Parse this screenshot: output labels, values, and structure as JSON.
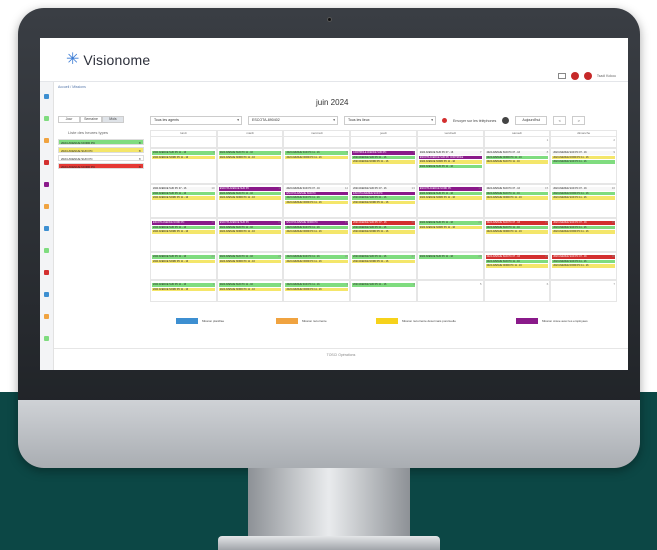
{
  "app": {
    "logo_text": "Visionome",
    "breadcrumb": "Accueil / Missions",
    "user": "Tsadi Kokou",
    "footer": "TOSCI Opérations"
  },
  "calendar": {
    "month_title": "juin 2024",
    "views": [
      "Jour",
      "Semaine",
      "Mois"
    ],
    "active_view": "Mois",
    "filters": {
      "agents": "Tous les agents",
      "code": "ESCOTA-890402",
      "lieux": "Tous les lieux"
    },
    "envoyer_label": "Envoyer sur les téléphones",
    "today_label": "Aujourd'hui",
    "prev_label": "<",
    "next_label": ">",
    "weekday_headers": [
      "lundi",
      "mardi",
      "mercredi",
      "jeudi",
      "vendredi",
      "samedi",
      "dimanche"
    ]
  },
  "legend": {
    "title": "Liste des heures types",
    "items": [
      {
        "label": "2024 AVENUE NORD PC",
        "color": "#7fdc7f"
      },
      {
        "label": "2024 AVENUE SUD PC",
        "color": "#f4e66a"
      },
      {
        "label": "2024 AVENUE SUD PC",
        "color": "#ffffff"
      },
      {
        "label": "2024 AVENUE NORD PC",
        "color": "#e53935"
      }
    ]
  },
  "weeks": [
    [
      {
        "n": "",
        "events": []
      },
      {
        "n": "",
        "events": []
      },
      {
        "n": "",
        "events": []
      },
      {
        "n": "",
        "events": []
      },
      {
        "n": "",
        "events": []
      },
      {
        "n": "1",
        "events": []
      },
      {
        "n": "2",
        "events": []
      }
    ],
    [
      {
        "n": "3",
        "events": [
          {
            "t": "2024 AVENUE SUD PC 11 - 16",
            "c": "green"
          },
          {
            "t": "2024 AVENUE NORD PC 11 - 16",
            "c": "yellow"
          }
        ]
      },
      {
        "n": "4",
        "events": [
          {
            "t": "2024 AVENUE SUD PC 11 - 16",
            "c": "green"
          },
          {
            "t": "2024 AVENUE NORD PC 11 - 16",
            "c": "yellow"
          }
        ]
      },
      {
        "n": "5",
        "events": [
          {
            "t": "2024 AVENUE SUD PC 11 - 16",
            "c": "green"
          },
          {
            "t": "2024 AVENUE NORD PC 11 - 16",
            "c": "yellow"
          }
        ]
      },
      {
        "n": "6",
        "events": [
          {
            "t": "CONTROLE AVENUE SUD PC",
            "c": "purple"
          },
          {
            "t": "2024 AVENUE SUD PC 11 - 16",
            "c": "green"
          },
          {
            "t": "2024 AVENUE NORD PC 11 - 16",
            "c": "yellow"
          }
        ]
      },
      {
        "n": "7",
        "events": [
          {
            "t": "2024 AVENUE SUD PC 07 - 16",
            "c": "white"
          },
          {
            "t": "ESCOTA AVENUE SUD PC CONTROLE",
            "c": "purple"
          },
          {
            "t": "2024 AVENUE NORD PC 11 - 16",
            "c": "yellow"
          },
          {
            "t": "2024 AVENUE SUD PC 11 - 16",
            "c": "green"
          }
        ]
      },
      {
        "n": "8",
        "events": [
          {
            "t": "2024 AVENUE SUD PC 07 - 16",
            "c": "white"
          },
          {
            "t": "2024 AVENUE NORD PC 11 - 16",
            "c": "green"
          },
          {
            "t": "2024 AVENUE SUD PC 11 - 16",
            "c": "yellow"
          }
        ]
      },
      {
        "n": "9",
        "events": [
          {
            "t": "2024 AVENUE SUD PC 07 - 16",
            "c": "white"
          },
          {
            "t": "2024 AVENUE NORD PC 11 - 16",
            "c": "yellow"
          },
          {
            "t": "2024 AVENUE SUD PC 11 - 16",
            "c": "green"
          }
        ]
      }
    ],
    [
      {
        "n": "10",
        "events": [
          {
            "t": "2024 AVENUE SUD PC 07 - 16",
            "c": "white"
          },
          {
            "t": "2024 AVENUE SUD PC 11 - 16",
            "c": "green"
          },
          {
            "t": "2024 AVENUE NORD PC 11 - 16",
            "c": "yellow"
          }
        ]
      },
      {
        "n": "11",
        "events": [
          {
            "t": "ESCOTA AVENUE SUD PC",
            "c": "purple"
          },
          {
            "t": "2024 AVENUE SUD PC 11 - 16",
            "c": "green"
          },
          {
            "t": "2024 AVENUE NORD PC 11 - 16",
            "c": "yellow"
          }
        ]
      },
      {
        "n": "12",
        "events": [
          {
            "t": "2024 AVENUE SUD PC 07 - 16",
            "c": "white"
          },
          {
            "t": "ESCOTA AVENUE SUD PC",
            "c": "purple"
          },
          {
            "t": "2024 AVENUE SUD PC 11 - 16",
            "c": "green"
          },
          {
            "t": "2024 AVENUE NORD PC 11 - 16",
            "c": "yellow"
          }
        ]
      },
      {
        "n": "13",
        "events": [
          {
            "t": "2024 AVENUE SUD PC 07 - 16",
            "c": "white"
          },
          {
            "t": "ESCOTA AVENUE SUD PC",
            "c": "purple"
          },
          {
            "t": "2024 AVENUE SUD PC 11 - 16",
            "c": "green"
          },
          {
            "t": "2024 AVENUE NORD PC 11 - 16",
            "c": "yellow"
          }
        ]
      },
      {
        "n": "14",
        "events": [
          {
            "t": "ESCOTA AVENUE NORD PC",
            "c": "purple"
          },
          {
            "t": "2024 AVENUE SUD PC 11 - 16",
            "c": "green"
          },
          {
            "t": "2024 AVENUE NORD PC 11 - 16",
            "c": "yellow"
          }
        ]
      },
      {
        "n": "15",
        "events": [
          {
            "t": "2024 AVENUE SUD PC 07 - 16",
            "c": "white"
          },
          {
            "t": "2024 AVENUE SUD PC 11 - 16",
            "c": "green"
          },
          {
            "t": "2024 AVENUE NORD PC 11 - 16",
            "c": "yellow"
          }
        ]
      },
      {
        "n": "16",
        "events": [
          {
            "t": "2024 AVENUE SUD PC 07 - 16",
            "c": "white"
          },
          {
            "t": "2024 AVENUE NORD PC 11 - 16",
            "c": "green"
          },
          {
            "t": "2024 AVENUE SUD PC 11 - 16",
            "c": "yellow"
          }
        ]
      }
    ],
    [
      {
        "n": "17",
        "events": [
          {
            "t": "ESCOTA AVENUE NORD PC",
            "c": "purple"
          },
          {
            "t": "2024 AVENUE SUD PC 11 - 16",
            "c": "green"
          },
          {
            "t": "2024 AVENUE NORD PC 11 - 16",
            "c": "yellow"
          }
        ]
      },
      {
        "n": "18",
        "events": [
          {
            "t": "ESCOTA AVENUE SUD PC",
            "c": "purple"
          },
          {
            "t": "2024 AVENUE SUD PC 11 - 16",
            "c": "green"
          },
          {
            "t": "2024 AVENUE NORD PC 11 - 16",
            "c": "yellow"
          }
        ]
      },
      {
        "n": "19",
        "events": [
          {
            "t": "ESCOTA AVENUE NORD PC",
            "c": "purple"
          },
          {
            "t": "2024 AVENUE SUD PC 11 - 16",
            "c": "green"
          },
          {
            "t": "2024 AVENUE NORD PC 11 - 16",
            "c": "yellow"
          }
        ]
      },
      {
        "n": "20",
        "events": [
          {
            "t": "2024 AVENUE SUD PC 07 - 16",
            "c": "red"
          },
          {
            "t": "2024 AVENUE SUD PC 11 - 16",
            "c": "green"
          },
          {
            "t": "2024 AVENUE NORD PC 11 - 16",
            "c": "yellow"
          }
        ]
      },
      {
        "n": "21",
        "events": [
          {
            "t": "2024 AVENUE SUD PC 11 - 16",
            "c": "green"
          },
          {
            "t": "2024 AVENUE NORD PC 11 - 16",
            "c": "yellow"
          }
        ]
      },
      {
        "n": "22",
        "events": [
          {
            "t": "2024 AVENUE SUD PC 07 - 16",
            "c": "red"
          },
          {
            "t": "2024 AVENUE SUD PC 11 - 16",
            "c": "green"
          },
          {
            "t": "2024 AVENUE NORD PC 11 - 16",
            "c": "yellow"
          }
        ]
      },
      {
        "n": "23",
        "events": [
          {
            "t": "2024 AVENUE SUD PC 07 - 16",
            "c": "red"
          },
          {
            "t": "2024 AVENUE SUD PC 11 - 16",
            "c": "green"
          },
          {
            "t": "2024 AVENUE NORD PC 11 - 16",
            "c": "yellow"
          }
        ]
      }
    ],
    [
      {
        "n": "24",
        "events": [
          {
            "t": "2024 AVENUE SUD PC 11 - 16",
            "c": "green"
          },
          {
            "t": "2024 AVENUE NORD PC 11 - 16",
            "c": "yellow"
          }
        ]
      },
      {
        "n": "25",
        "events": [
          {
            "t": "2024 AVENUE SUD PC 11 - 16",
            "c": "green"
          },
          {
            "t": "2024 AVENUE NORD PC 11 - 16",
            "c": "yellow"
          }
        ]
      },
      {
        "n": "26",
        "events": [
          {
            "t": "2024 AVENUE SUD PC 11 - 16",
            "c": "green"
          },
          {
            "t": "2024 AVENUE NORD PC 11 - 16",
            "c": "yellow"
          }
        ]
      },
      {
        "n": "27",
        "events": [
          {
            "t": "2024 AVENUE SUD PC 11 - 16",
            "c": "green"
          },
          {
            "t": "2024 AVENUE NORD PC 11 - 16",
            "c": "yellow"
          }
        ]
      },
      {
        "n": "28",
        "events": [
          {
            "t": "2024 AVENUE SUD PC 11 - 16",
            "c": "green"
          }
        ]
      },
      {
        "n": "29",
        "events": [
          {
            "t": "2024 AVENUE SUD PC 07 - 16",
            "c": "red"
          },
          {
            "t": "2024 AVENUE SUD PC 11 - 16",
            "c": "green"
          },
          {
            "t": "2024 AVENUE NORD PC 11 - 16",
            "c": "yellow"
          }
        ]
      },
      {
        "n": "30",
        "events": [
          {
            "t": "2024 AVENUE SUD PC 07 - 16",
            "c": "red"
          },
          {
            "t": "2024 AVENUE SUD PC 11 - 16",
            "c": "green"
          },
          {
            "t": "2024 AVENUE NORD PC 11 - 16",
            "c": "yellow"
          }
        ]
      }
    ],
    [
      {
        "n": "1",
        "events": [
          {
            "t": "2024 AVENUE SUD PC 11 - 16",
            "c": "green"
          },
          {
            "t": "2024 AVENUE NORD PC 11 - 16",
            "c": "yellow"
          }
        ]
      },
      {
        "n": "2",
        "events": [
          {
            "t": "2024 AVENUE SUD PC 11 - 16",
            "c": "green"
          },
          {
            "t": "2024 AVENUE NORD PC 11 - 16",
            "c": "yellow"
          }
        ]
      },
      {
        "n": "3",
        "events": [
          {
            "t": "2024 AVENUE SUD PC 11 - 16",
            "c": "green"
          },
          {
            "t": "2024 AVENUE NORD PC 11 - 16",
            "c": "yellow"
          }
        ]
      },
      {
        "n": "4",
        "events": [
          {
            "t": "2024 AVENUE SUD PC 11 - 16",
            "c": "green"
          }
        ]
      },
      {
        "n": "5",
        "events": []
      },
      {
        "n": "6",
        "events": []
      },
      {
        "n": "7",
        "events": []
      }
    ]
  ],
  "event_colors": {
    "green": "#7fdc7f",
    "yellow": "#f4e66a",
    "purple": "#8a1a8a",
    "red": "#d32f2f",
    "white": "#f7f7f7"
  },
  "status_key": [
    {
      "label": "Mission planifiée",
      "color": "#3d8fd1"
    },
    {
      "label": "Mission récurrente",
      "color": "#f0a340"
    },
    {
      "label": "Mission récurrente désormais ponctuelle",
      "color": "#f6d21b"
    },
    {
      "label": "Mission créée avec les employées",
      "color": "#8a1a8a"
    }
  ]
}
